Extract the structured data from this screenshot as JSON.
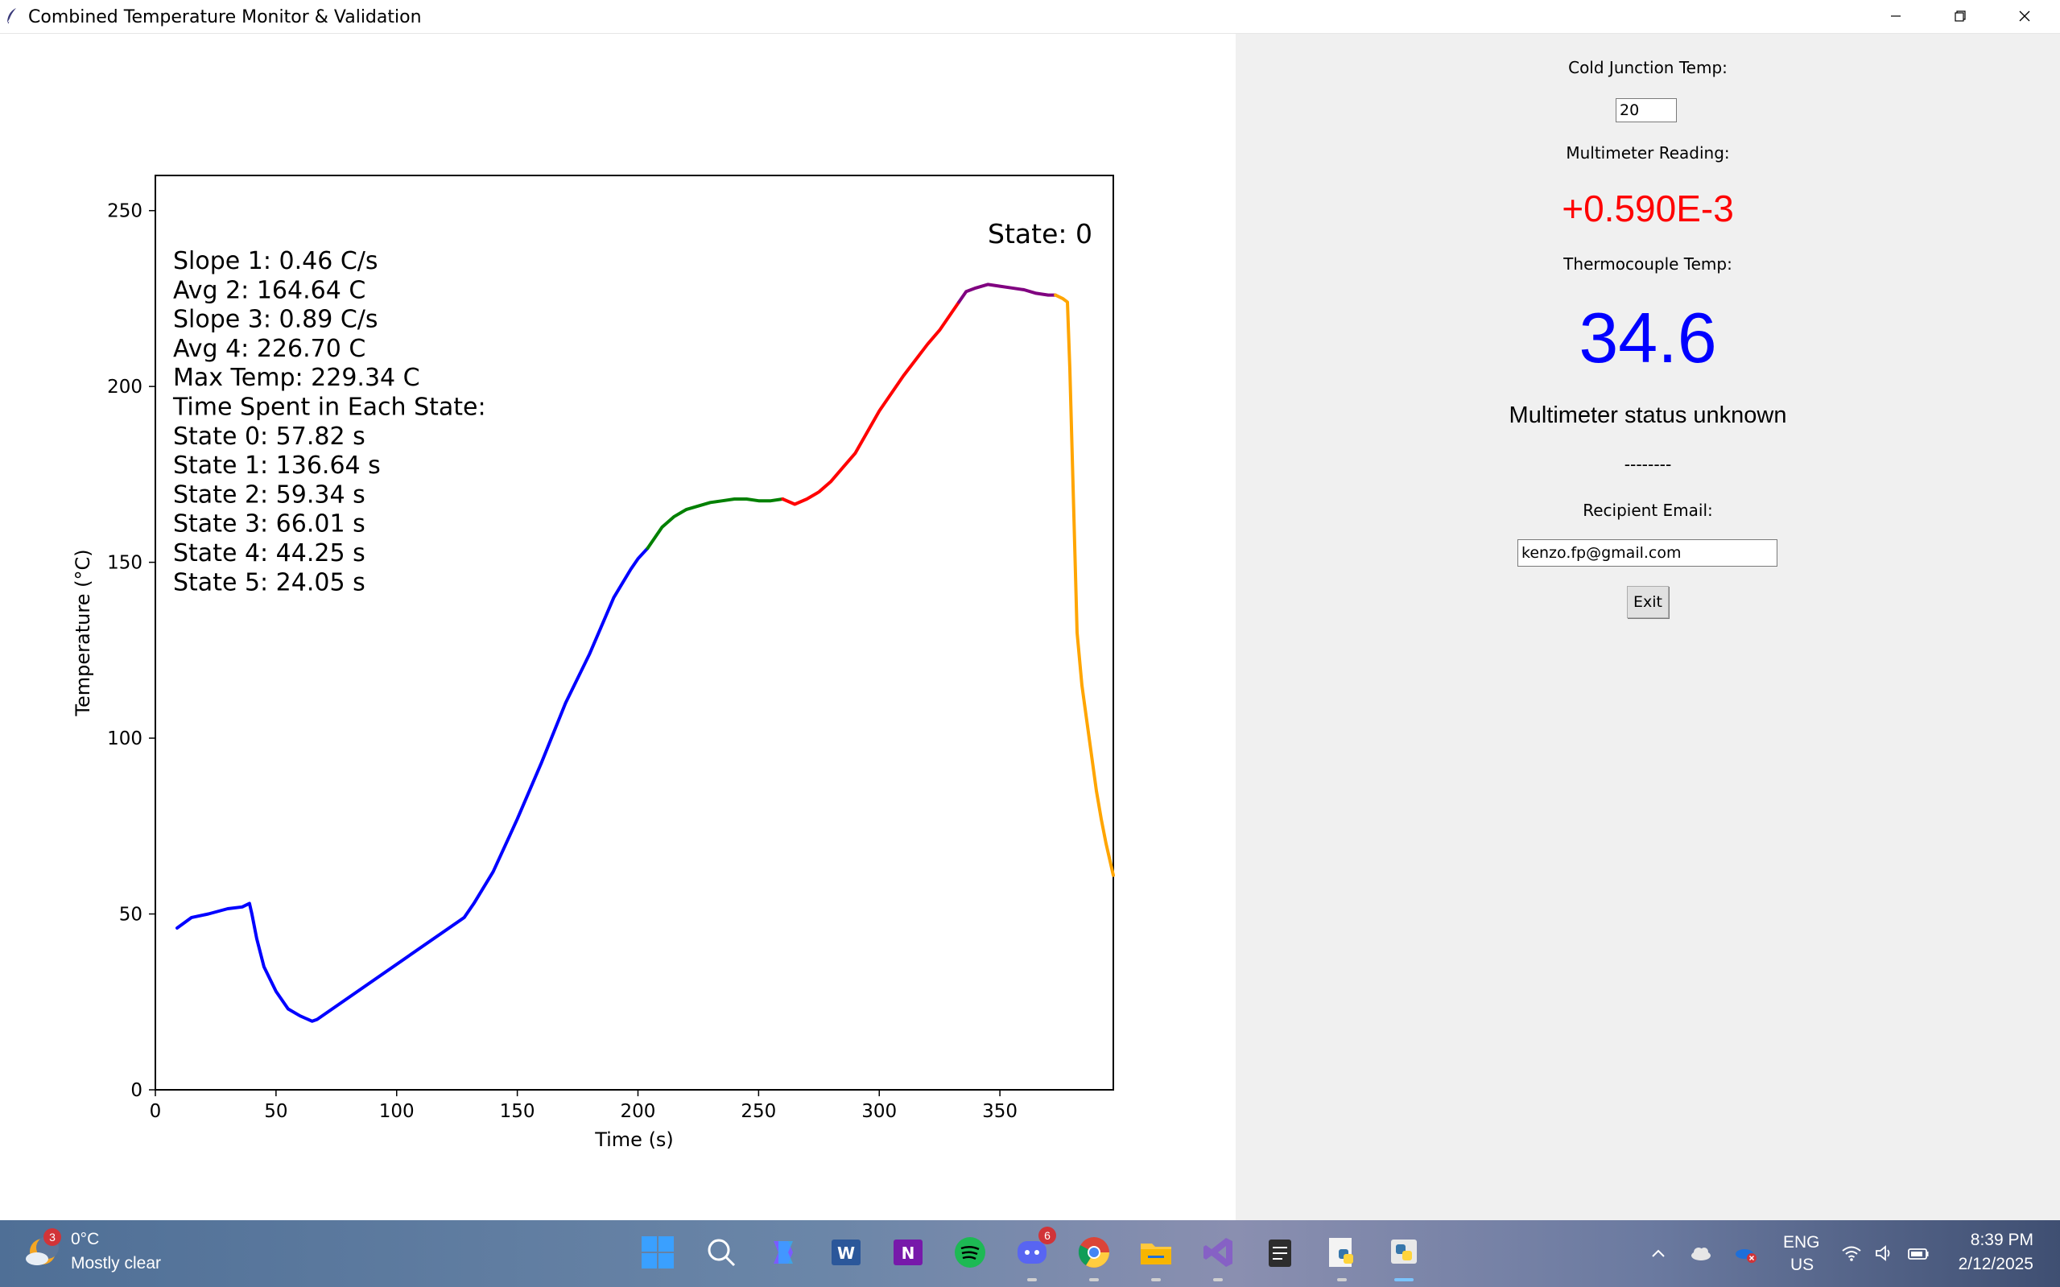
{
  "window": {
    "title": "Combined Temperature Monitor & Validation"
  },
  "panel": {
    "cold_junction_label": "Cold Junction Temp:",
    "cold_junction_value": "20",
    "multimeter_label": "Multimeter Reading:",
    "multimeter_value": "+0.590E-3",
    "thermocouple_label": "Thermocouple Temp:",
    "thermocouple_value": "34.6",
    "status_text": "Multimeter status unknown",
    "separator": "--------",
    "email_label": "Recipient Email:",
    "email_value": "kenzo.fp@gmail.com",
    "exit_label": "Exit"
  },
  "colors": {
    "multimeter_value": "#ff0000",
    "thermocouple_value": "#0000ff",
    "state_colors": [
      "#0000ff",
      "#008000",
      "#ff0000",
      "#800080",
      "#ffa500"
    ]
  },
  "chart_data": {
    "type": "line",
    "xlabel": "Time (s)",
    "ylabel": "Temperature (°C)",
    "xlim": [
      0,
      397
    ],
    "ylim": [
      0,
      260
    ],
    "xticks": [
      0,
      50,
      100,
      150,
      200,
      250,
      300,
      350
    ],
    "yticks": [
      0,
      50,
      100,
      150,
      200,
      250
    ],
    "state_annotation": "State: 0",
    "stats_lines": [
      "Slope 1: 0.46 C/s",
      "Avg 2: 164.64 C",
      "Slope 3: 0.89 C/s",
      "Avg 4: 226.70 C",
      "Max Temp: 229.34 C",
      "Time Spent in Each State:",
      "State 0: 57.82 s",
      "State 1: 136.64 s",
      "State 2: 59.34 s",
      "State 3: 66.01 s",
      "State 4: 44.25 s",
      "State 5: 24.05 s"
    ],
    "series": [
      {
        "color": "#0000ff",
        "x": [
          9,
          15,
          22,
          30,
          36,
          39,
          40,
          42,
          45,
          50,
          55,
          60,
          65,
          67,
          128,
          132,
          140,
          150,
          160,
          170,
          180,
          190,
          197,
          200,
          204
        ],
        "y": [
          46,
          49,
          50,
          51.5,
          52,
          53,
          50,
          43,
          35,
          28,
          23,
          21,
          19.5,
          20,
          49,
          53,
          62,
          77,
          93,
          110,
          124,
          140,
          148,
          151,
          154
        ]
      },
      {
        "color": "#008000",
        "x": [
          204,
          210,
          215,
          220,
          225,
          230,
          235,
          240,
          245,
          250,
          255,
          260
        ],
        "y": [
          154,
          160,
          163,
          165,
          166,
          167,
          167.5,
          168,
          168,
          167.5,
          167.5,
          168
        ]
      },
      {
        "color": "#ff0000",
        "x": [
          260,
          265,
          270,
          275,
          280,
          285,
          290,
          300,
          310,
          320,
          325,
          330,
          333
        ],
        "y": [
          168,
          166.5,
          168,
          170,
          173,
          177,
          181,
          193,
          203,
          212,
          216,
          221,
          224
        ]
      },
      {
        "color": "#800080",
        "x": [
          333,
          336,
          340,
          345,
          350,
          355,
          360,
          365,
          370,
          373
        ],
        "y": [
          224,
          227,
          228,
          229,
          228.5,
          228,
          227.5,
          226.5,
          226,
          226
        ]
      },
      {
        "color": "#ffa500",
        "x": [
          373,
          376,
          378,
          379,
          380,
          381,
          382,
          384,
          386,
          388,
          390,
          392,
          394,
          396,
          397
        ],
        "y": [
          226,
          225,
          224,
          205,
          180,
          155,
          130,
          115,
          105,
          95,
          85,
          77,
          70,
          64,
          61
        ]
      }
    ]
  },
  "taskbar": {
    "weather_temp": "0°C",
    "weather_desc": "Mostly clear",
    "weather_badge": "3",
    "discord_badge": "6",
    "lang_line1": "ENG",
    "lang_line2": "US",
    "time": "8:39 PM",
    "date": "2/12/2025"
  }
}
